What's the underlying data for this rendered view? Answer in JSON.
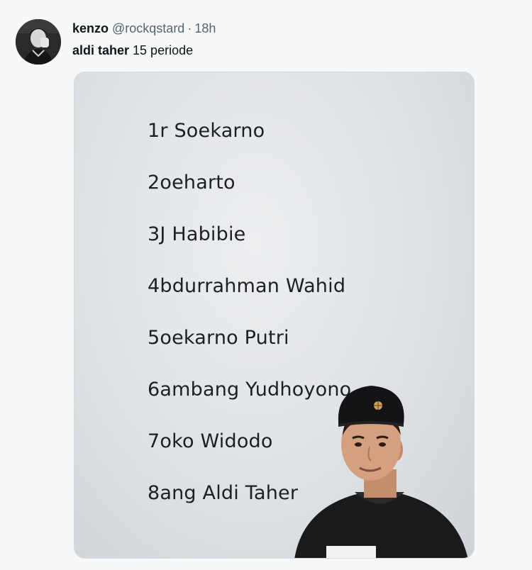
{
  "tweet": {
    "author": {
      "display_name": "kenzo",
      "handle": "@rockqstard",
      "separator": "·",
      "time": "18h"
    },
    "text": {
      "mention": "aldi taher",
      "body": " 15 periode"
    }
  },
  "media": {
    "list_items": [
      "1r Soekarno",
      "2oeharto",
      "3J Habibie",
      "4bdurrahman Wahid",
      "5oekarno Putri",
      "6ambang Yudhoyono",
      "7oko Widodo",
      "8ang Aldi Taher"
    ],
    "icons": [
      "avatar-photo",
      "person-photo"
    ]
  },
  "colors": {
    "background": "#f7f9f9",
    "text_primary": "#0f1419",
    "text_secondary": "#536471",
    "paper": "#e4e6e9",
    "list_text": "#1d1f22"
  }
}
